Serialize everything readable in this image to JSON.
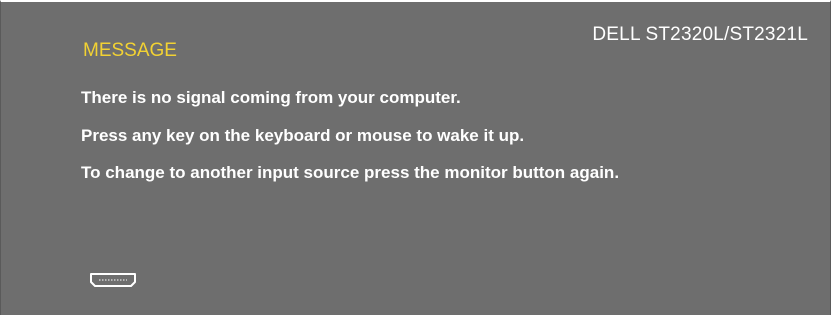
{
  "osd": {
    "model": "DELL  ST2320L/ST2321L",
    "title": "MESSAGE",
    "lines": [
      "There is no signal coming from your computer.",
      "Press any key on the keyboard or mouse to wake it up.",
      "To change to another input source press the monitor button again."
    ],
    "input_icon": "hdmi-port-icon"
  },
  "colors": {
    "background": "#6e6e6e",
    "title": "#f2d233",
    "text": "#ffffff"
  }
}
